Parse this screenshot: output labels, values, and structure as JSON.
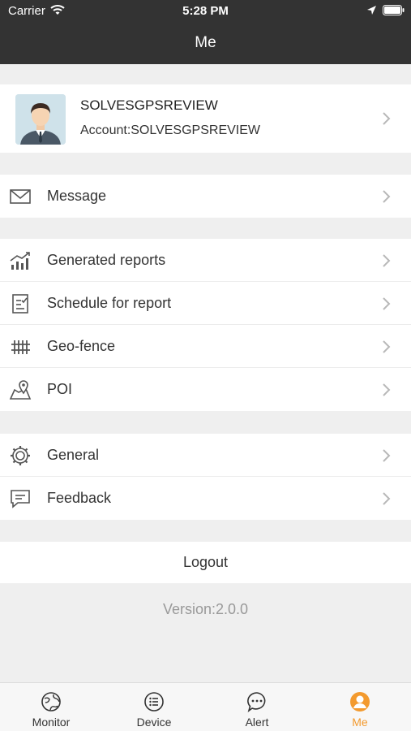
{
  "status_bar": {
    "carrier": "Carrier",
    "time": "5:28 PM"
  },
  "header": {
    "title": "Me"
  },
  "profile": {
    "name": "SOLVESGPSREVIEW",
    "account": "Account:SOLVESGPSREVIEW"
  },
  "menu": {
    "message": "Message",
    "generated_reports": "Generated reports",
    "schedule_for_report": "Schedule for report",
    "geo_fence": "Geo-fence",
    "poi": "POI",
    "general": "General",
    "feedback": "Feedback"
  },
  "logout_label": "Logout",
  "version": "Version:2.0.0",
  "tabs": [
    {
      "label": "Monitor",
      "icon": "monitor-icon"
    },
    {
      "label": "Device",
      "icon": "device-list-icon"
    },
    {
      "label": "Alert",
      "icon": "alert-bubble-icon"
    },
    {
      "label": "Me",
      "icon": "me-person-icon",
      "active": true
    }
  ],
  "colors": {
    "header_bg": "#333333",
    "accent": "#f39a2e",
    "page_bg": "#efefef"
  }
}
